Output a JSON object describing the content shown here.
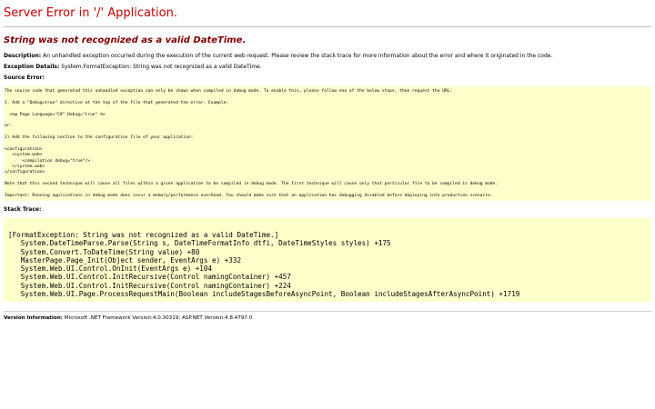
{
  "page": {
    "title": "Server Error in '/' Application.",
    "subtitle": "String was not recognized as a valid DateTime.",
    "description_label": "Description:",
    "description_text": " An unhandled exception occurred during the execution of the current web request. Please review the stack trace for more information about the error and where it originated in the code.",
    "exception_label": "Exception Details:",
    "exception_text": " System.FormatException: String was not recognized as a valid DateTime.",
    "source_error_label": "Source Error:",
    "stack_trace_label": "Stack Trace:",
    "version_label": "Version Information:",
    "version_text": " Microsoft .NET Framework Version:4.0.30319; ASP.NET Version:4.8.4797.0"
  },
  "source_error_lines": [
    "The source code that generated this unhandled exception can only be shown when compiled in debug mode. To enable this, please follow one of the below steps, then request the URL:",
    "",
    "1. Add a \"Debug=true\" directive at the top of the file that generated the error. Example:",
    "",
    "  <%@ Page Language=\"C#\" Debug=\"true\" %>",
    "",
    "or:",
    "",
    "2) Add the following section to the configuration file of your application:",
    "",
    "<configuration>",
    "   <system.web>",
    "       <compilation debug=\"true\"/>",
    "   </system.web>",
    "</configuration>",
    "",
    "Note that this second technique will cause all files within a given application to be compiled in debug mode. The first technique will cause only that particular file to be compiled in debug mode.",
    "",
    "Important: Running applications in debug mode does incur a memory/performance overhead. You should make sure that an application has debugging disabled before deploying into production scenario."
  ],
  "stack_trace_lines": [
    "[FormatException: String was not recognized as a valid DateTime.]",
    "   System.DateTimeParse.Parse(String s, DateTimeFormatInfo dtfi, DateTimeStyles styles) +175",
    "   System.Convert.ToDateTime(String value) +80",
    "   MasterPage.Page_Init(Object sender, EventArgs e) +332",
    "   System.Web.UI.Control.OnInit(EventArgs e) +104",
    "   System.Web.UI.Control.InitRecursive(Control namingContainer) +457",
    "   System.Web.UI.Control.InitRecursive(Control namingContainer) +224",
    "   System.Web.UI.Page.ProcessRequestMain(Boolean includeStagesBeforeAsyncPoint, Boolean includeStagesAfterAsyncPoint) +1719"
  ],
  "colors": {
    "title": "#c00000",
    "subtitle": "#800000",
    "code_background": "#ffffcc"
  }
}
